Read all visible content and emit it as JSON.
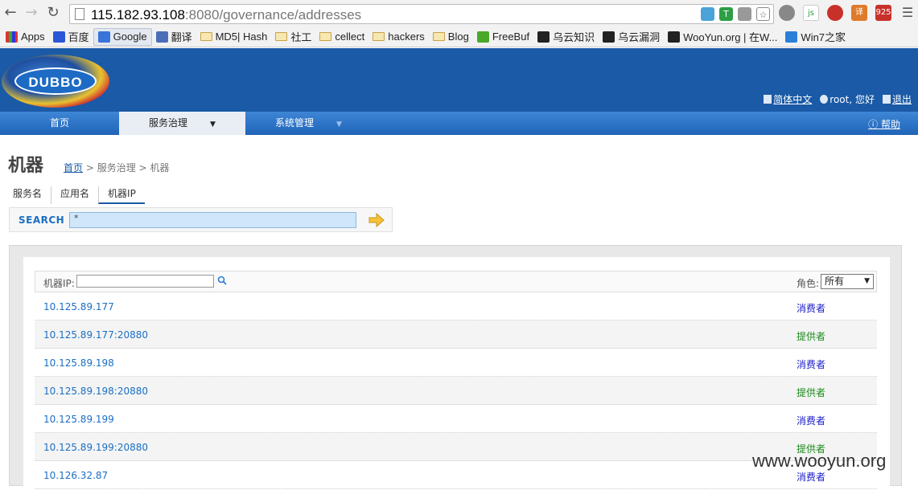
{
  "browser": {
    "url_host": "115.182.93.108",
    "url_path": ":8080/governance/addresses",
    "bookmarks": [
      "Apps",
      "百度",
      "Google",
      "翻译",
      "MD5| Hash",
      "社工",
      "cellect",
      "hackers",
      "Blog",
      "FreeBuf",
      "乌云知识",
      "乌云漏洞",
      "WooYun.org | 在W...",
      "Win7之家"
    ]
  },
  "header": {
    "logo_text": "DUBBO",
    "lang_link": "简体中文",
    "user_text": "root, 您好",
    "logout_link": "退出"
  },
  "menu": {
    "home": "首页",
    "governance": "服务治理",
    "system": "系统管理",
    "help": "帮助"
  },
  "page": {
    "title": "机器",
    "breadcrumb_home": "首页",
    "breadcrumb_rest": " > 服务治理 > 机器",
    "tabs": [
      "服务名",
      "应用名",
      "机器IP"
    ]
  },
  "search": {
    "label": "SEARCH",
    "value": "*"
  },
  "filter": {
    "label": "机器IP:",
    "role_label": "角色:",
    "role_selected": "所有"
  },
  "colors": {
    "brand_blue": "#1a5aa6",
    "consumer": "#1a1ac4",
    "provider": "#1a8a1a"
  },
  "rows": [
    {
      "address": "10.125.89.177",
      "role": "消费者",
      "type": "consumer"
    },
    {
      "address": "10.125.89.177:20880",
      "role": "提供者",
      "type": "provider"
    },
    {
      "address": "10.125.89.198",
      "role": "消费者",
      "type": "consumer"
    },
    {
      "address": "10.125.89.198:20880",
      "role": "提供者",
      "type": "provider"
    },
    {
      "address": "10.125.89.199",
      "role": "消费者",
      "type": "consumer"
    },
    {
      "address": "10.125.89.199:20880",
      "role": "提供者",
      "type": "provider"
    },
    {
      "address": "10.126.32.87",
      "role": "消费者",
      "type": "consumer"
    }
  ],
  "watermark": "www.wooyun.org"
}
